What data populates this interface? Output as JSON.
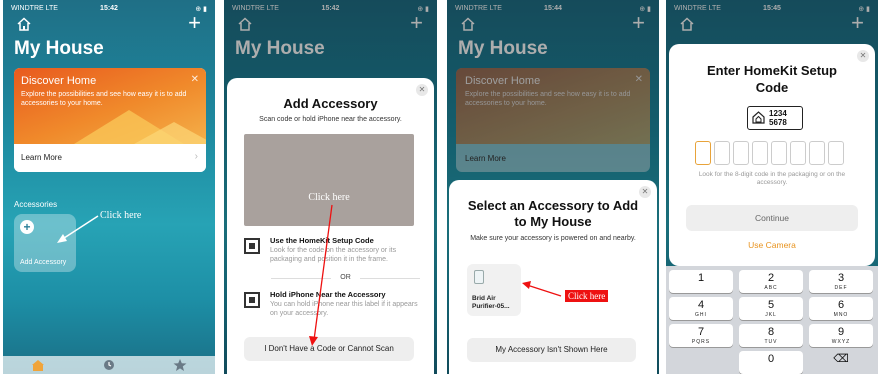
{
  "status_bars": [
    {
      "carrier": "WINDTRE LTE",
      "time": "15:42"
    },
    {
      "carrier": "WINDTRE LTE",
      "time": "15:42"
    },
    {
      "carrier": "WINDTRE LTE",
      "time": "15:44"
    },
    {
      "carrier": "WINDTRE LTE",
      "time": "15:45"
    }
  ],
  "home": {
    "title": "My House",
    "discover_title": "Discover Home",
    "discover_text": "Explore the possibilities and see how easy it is to add accessories to your home.",
    "learn_more": "Learn More",
    "accessories_label": "Accessories",
    "add_accessory": "Add Accessory",
    "click_here": "Click here"
  },
  "add_accessory_sheet": {
    "title": "Add Accessory",
    "subtitle": "Scan code or hold iPhone near the accessory.",
    "click_here": "Click here",
    "option1_title": "Use the HomeKit Setup Code",
    "option1_desc": "Look for the code on the accessory or its packaging and position it in the frame.",
    "or": "OR",
    "option2_title": "Hold iPhone Near the Accessory",
    "option2_desc": "You can hold iPhone near this label if it appears on your accessory.",
    "no_code_button": "I Don't Have a Code or Cannot Scan"
  },
  "select_sheet": {
    "title": "Select an Accessory to Add to My House",
    "subtitle": "Make sure your accessory is powered on and nearby.",
    "device_name": "Brid Air Purifier-05...",
    "click_here": "Click here",
    "not_shown_button": "My Accessory Isn't Shown Here"
  },
  "setup_code_sheet": {
    "title": "Enter HomeKit Setup Code",
    "code_line1": "1234",
    "code_line2": "5678",
    "hint": "Look for the 8-digit code in the packaging or on the accessory.",
    "continue": "Continue",
    "use_camera": "Use Camera"
  },
  "keypad": [
    {
      "num": "1",
      "letters": ""
    },
    {
      "num": "2",
      "letters": "ABC"
    },
    {
      "num": "3",
      "letters": "DEF"
    },
    {
      "num": "4",
      "letters": "GHI"
    },
    {
      "num": "5",
      "letters": "JKL"
    },
    {
      "num": "6",
      "letters": "MNO"
    },
    {
      "num": "7",
      "letters": "PQRS"
    },
    {
      "num": "8",
      "letters": "TUV"
    },
    {
      "num": "9",
      "letters": "WXYZ"
    },
    {
      "num": "0",
      "letters": ""
    }
  ],
  "colors": {
    "accent_orange": "#e8931e",
    "annotation_red": "#e11111"
  },
  "icons": {
    "home": "house-icon",
    "add": "plus-icon",
    "close": "close-icon",
    "qr": "qr-code-icon",
    "nfc": "nfc-label-icon",
    "delete": "backspace-icon"
  }
}
